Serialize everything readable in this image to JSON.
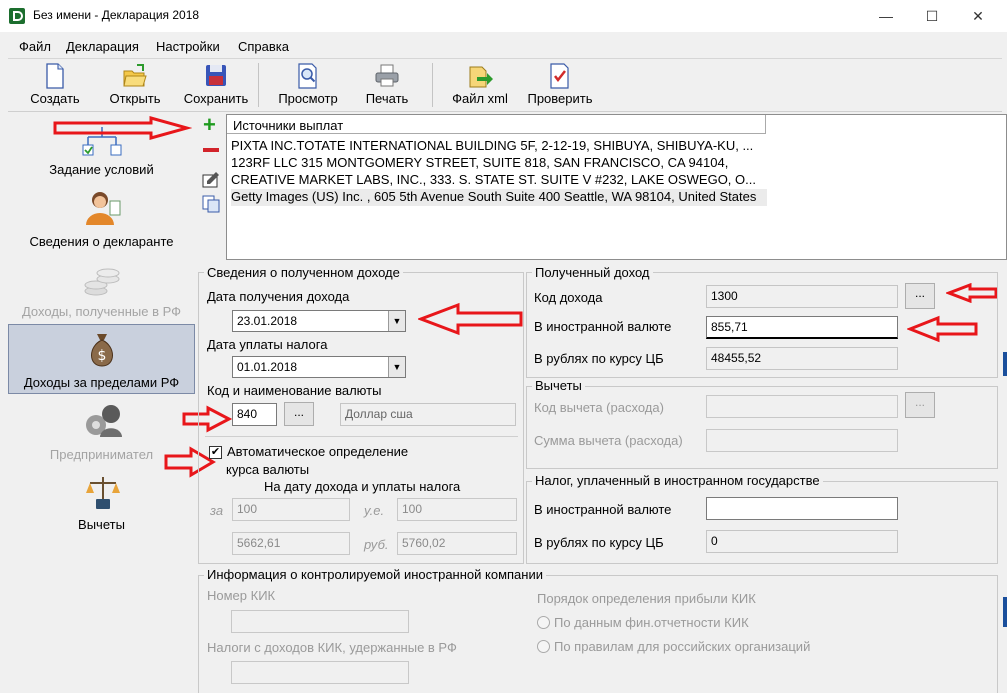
{
  "window": {
    "title": "Без имени - Декларация 2018",
    "minimize": "—",
    "maximize": "☐",
    "close": "✕"
  },
  "menu": [
    "Файл",
    "Декларация",
    "Настройки",
    "Справка"
  ],
  "toolbar": {
    "create": "Создать",
    "open": "Открыть",
    "save": "Сохранить",
    "preview": "Просмотр",
    "print": "Печать",
    "xml": "Файл xml",
    "check": "Проверить"
  },
  "nav": {
    "conditions": "Задание условий",
    "declarant": "Сведения о декларанте",
    "income_rf": "Доходы, полученные в РФ",
    "income_abroad": "Доходы за пределами РФ",
    "entrepreneur": "Предпринимател",
    "deductions": "Вычеты"
  },
  "sources": {
    "header": "Источники выплат",
    "rows": [
      "PIXTA INC.TOTATE INTERNATIONAL BUILDING 5F, 2-12-19, SHIBUYA, SHIBUYA-KU, ...",
      "123RF LLC 315 MONTGOMERY STREET, SUITE 818, SAN FRANCISCO, CA 94104,",
      "CREATIVE MARKET LABS, INC., 333. S. STATE ST. SUITE V #232, LAKE OSWEGO, O...",
      "Getty Images (US) Inc. , 605 5th Avenue South Suite 400 Seattle, WA 98104, United States"
    ]
  },
  "income_info": {
    "title": "Сведения о полученном доходе",
    "date_received_label": "Дата получения дохода",
    "date_received": "23.01.2018",
    "date_paid_label": "Дата уплаты налога",
    "date_paid": "01.01.2018",
    "currency_label": "Код и наименование валюты",
    "currency_code": "840",
    "currency_btn": "...",
    "currency_name": "Доллар сша",
    "auto_rate_label": "Автоматическое определение",
    "auto_rate_label2": "курса валюты",
    "auto_rate_checked": "✔",
    "rate_date_label": "На дату дохода и уплаты налога",
    "per_label": "за",
    "units_label": "у.е.",
    "rub_label": "руб.",
    "per_income": "100",
    "per_tax": "100",
    "rub_income": "5662,61",
    "rub_tax": "5760,02"
  },
  "received_income": {
    "title": "Полученный доход",
    "code_label": "Код дохода",
    "code": "1300",
    "code_btn": "...",
    "foreign_label": "В иностранной валюте",
    "foreign": "855,71",
    "rub_label": "В рублях по курсу ЦБ",
    "rub": "48455,52"
  },
  "deductions": {
    "title": "Вычеты",
    "code_label": "Код вычета (расхода)",
    "btn": "...",
    "sum_label": "Сумма вычета (расхода)"
  },
  "foreign_tax": {
    "title": "Налог, уплаченный в иностранном государстве",
    "foreign_label": "В иностранной валюте",
    "foreign": "",
    "rub_label": "В рублях по курсу ЦБ",
    "rub": "0"
  },
  "kik": {
    "title": "Информация о контролируемой иностранной компании",
    "number_label": "Номер КИК",
    "tax_label": "Налоги с доходов КИК, удержанные в РФ",
    "profit_order_label": "Порядок определения прибыли КИК",
    "option1": "По данным фин.отчетности КИК",
    "option2": "По правилам для российских организаций"
  },
  "colors": {
    "arrow_red": "#e8161a",
    "plus_green": "#1f9b1f",
    "minus_red": "#d2232a"
  }
}
